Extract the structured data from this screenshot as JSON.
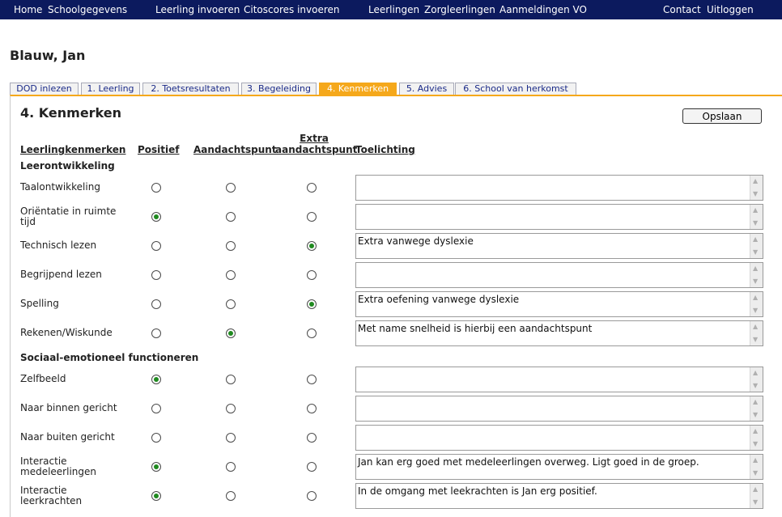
{
  "nav": {
    "items": [
      "Home",
      "Schoolgegevens",
      "Leerling invoeren",
      "Citoscores invoeren",
      "Leerlingen",
      "Zorgleerlingen",
      "Aanmeldingen VO",
      "Contact",
      "Uitloggen"
    ]
  },
  "student": {
    "name": "Blauw, Jan"
  },
  "tabs": [
    "DOD inlezen",
    "1. Leerling",
    "2. Toetsresultaten",
    "3. Begeleiding",
    "4. Kenmerken",
    "5. Advies",
    "6. School van herkomst"
  ],
  "active_tab": "4. Kenmerken",
  "section": {
    "title": "4. Kenmerken",
    "save_label": "Opslaan"
  },
  "columns": {
    "kenmerken": "Leerlingkenmerken",
    "positief": "Positief",
    "aandachtspunt": "Aandachtspunt",
    "extra_line1": "Extra",
    "extra_line2": "aandachtspunt",
    "toelichting": "Toelichting"
  },
  "groups": [
    {
      "title": "Leerontwikkeling",
      "rows": [
        {
          "label": "Taalontwikkeling",
          "selected": "none",
          "note": ""
        },
        {
          "label": "Oriëntatie in ruimte tijd",
          "selected": "positief",
          "note": ""
        },
        {
          "label": "Technisch lezen",
          "selected": "extra",
          "note": "Extra vanwege dyslexie"
        },
        {
          "label": "Begrijpend lezen",
          "selected": "none",
          "note": ""
        },
        {
          "label": "Spelling",
          "selected": "extra",
          "note": "Extra oefening vanwege dyslexie"
        },
        {
          "label": "Rekenen/Wiskunde",
          "selected": "aandachtspunt",
          "note": "Met name snelheid is hierbij een aandachtspunt"
        }
      ]
    },
    {
      "title": "Sociaal-emotioneel functioneren",
      "rows": [
        {
          "label": "Zelfbeeld",
          "selected": "positief",
          "note": ""
        },
        {
          "label": "Naar binnen gericht",
          "selected": "none",
          "note": ""
        },
        {
          "label": "Naar buiten gericht",
          "selected": "none",
          "note": ""
        },
        {
          "label": "Interactie medeleerlingen",
          "selected": "positief",
          "note": "Jan kan erg goed met medeleerlingen overweg. Ligt goed in de groep."
        },
        {
          "label": "Interactie leerkrachten",
          "selected": "positief",
          "note": "In de omgang met leekrachten is Jan erg positief."
        }
      ]
    }
  ],
  "colors": {
    "navbar": "#0c1a5e",
    "active_tab": "#f5a81b",
    "radio_selected": "#1f8a1f"
  }
}
